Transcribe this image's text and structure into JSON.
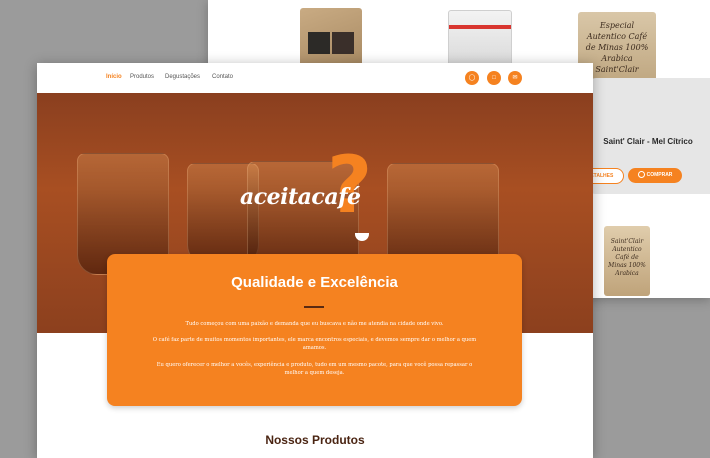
{
  "back_page": {
    "product_name": "Saint' Clair - Mel Cítrico",
    "details_button": "DETALHES",
    "buy_button": "COMPRAR",
    "bag3_text": "Especial Autentico Café de Minas 100% Arabica Saint'Clair",
    "bag4_text": "Saint'Clair Autentico Café de Minas 100% Arabica"
  },
  "nav": {
    "items": [
      "Início",
      "Produtos",
      "Degustações",
      "Contato"
    ],
    "icons": [
      "whatsapp-icon",
      "instagram-icon",
      "email-icon"
    ],
    "accent": "#f58220"
  },
  "hero": {
    "logo_part1": "aceita",
    "logo_part2": "café"
  },
  "banner": {
    "title": "Qualidade e Excelência",
    "paragraphs": [
      "Tudo começou com uma paixão e demanda que eu buscava e não me atendia na cidade onde vivo.",
      "O café faz parte de muitos momentos importantes, ele marca encontros especiais, e devemos sempre dar o melhor a quem amamos.",
      "Eu quero oferecer o melhor a vocês, experiência e produto, tudo em um mesmo pacote, para que você possa repassar o melhor a quem deseja."
    ]
  },
  "section": {
    "title": "Nossos Produtos"
  }
}
